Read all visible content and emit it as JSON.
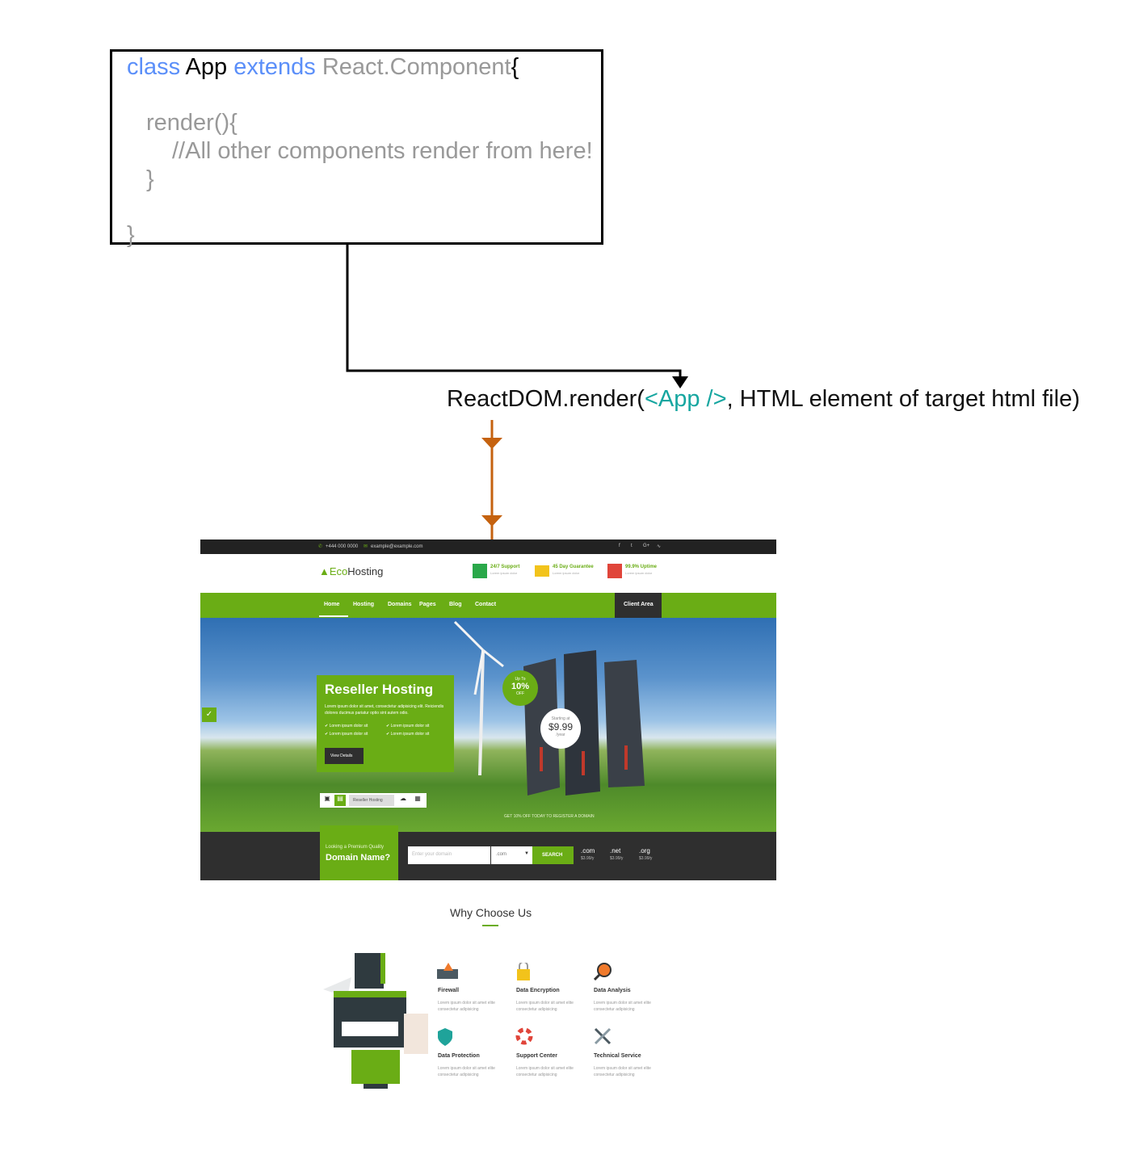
{
  "code": {
    "line1": {
      "kw1": "class",
      "name": "App",
      "kw2": "extends",
      "base": "React.Component",
      "brace": "{"
    },
    "line2": "render(){",
    "line3": "//All other components render from here!",
    "line4": "}",
    "line5": "}"
  },
  "render_call": {
    "prefix": "ReactDOM.render(",
    "app": "<App />",
    "suffix": ", HTML element of target html file)"
  },
  "site": {
    "topbar": {
      "phone": "+444 000 0000",
      "email": "example@example.com"
    },
    "logo": {
      "eco": "Eco",
      "hosting": "Hosting"
    },
    "features": [
      {
        "title": "24/7 Support",
        "desc": "Lorem ipsum dolor"
      },
      {
        "title": "45 Day Guarantee",
        "desc": "Lorem ipsum dolor"
      },
      {
        "title": "99.9% Uptime",
        "desc": "Lorem ipsum dolor"
      }
    ],
    "nav": [
      "Home",
      "Hosting",
      "Domains",
      "Pages",
      "Blog",
      "Contact"
    ],
    "client_area": "Client Area",
    "hero": {
      "title": "Reseller Hosting",
      "text": "Lorem ipsum dolor sit amet, consectetur adipisicing elit. Reiciendis dolores ducimus pariatur optio sint autem odio.",
      "bullets": [
        "Lorem ipsum dolor sit",
        "Lorem ipsum dolor sit",
        "Lorem ipsum dolor sit",
        "Lorem ipsum dolor sit"
      ],
      "button": "View Details",
      "tab_label": "Reseller Hosting",
      "discount": {
        "upto": "Up To",
        "value": "10%",
        "off": "OFF"
      },
      "price": {
        "starting": "Starting at",
        "value": "$9.99",
        "per": "/year"
      },
      "promo": "GET 10% OFF TODAY TO REGISTER A DOMAIN"
    },
    "domain": {
      "looking": "Looking a Premium Quality",
      "title": "Domain Name?",
      "placeholder": "Enter your domain",
      "ext_selected": ".com",
      "search": "SEARCH",
      "tlds": [
        {
          "ext": ".com",
          "price": "$3.99/y"
        },
        {
          "ext": ".net",
          "price": "$3.99/y"
        },
        {
          "ext": ".org",
          "price": "$3.99/y"
        }
      ]
    },
    "why": {
      "title": "Why Choose Us",
      "items": [
        {
          "title": "Firewall",
          "desc": "Lorem ipsum dolor sit amet elite consectetur adipisicing"
        },
        {
          "title": "Data Encryption",
          "desc": "Lorem ipsum dolor sit amet elite consectetur adipisicing"
        },
        {
          "title": "Data Analysis",
          "desc": "Lorem ipsum dolor sit amet elite consectetur adipisicing"
        },
        {
          "title": "Data Protection",
          "desc": "Lorem ipsum dolor sit amet elite consectetur adipisicing"
        },
        {
          "title": "Support Center",
          "desc": "Lorem ipsum dolor sit amet elite consectetur adipisicing"
        },
        {
          "title": "Technical Service",
          "desc": "Lorem ipsum dolor sit amet elite consectetur adipisicing"
        }
      ]
    }
  },
  "colors": {
    "arrow_black": "#000000",
    "arrow_orange": "#c5620f",
    "brand_green": "#6aad15",
    "keyword_blue": "#5b8ff9",
    "teal": "#16a6a0"
  }
}
